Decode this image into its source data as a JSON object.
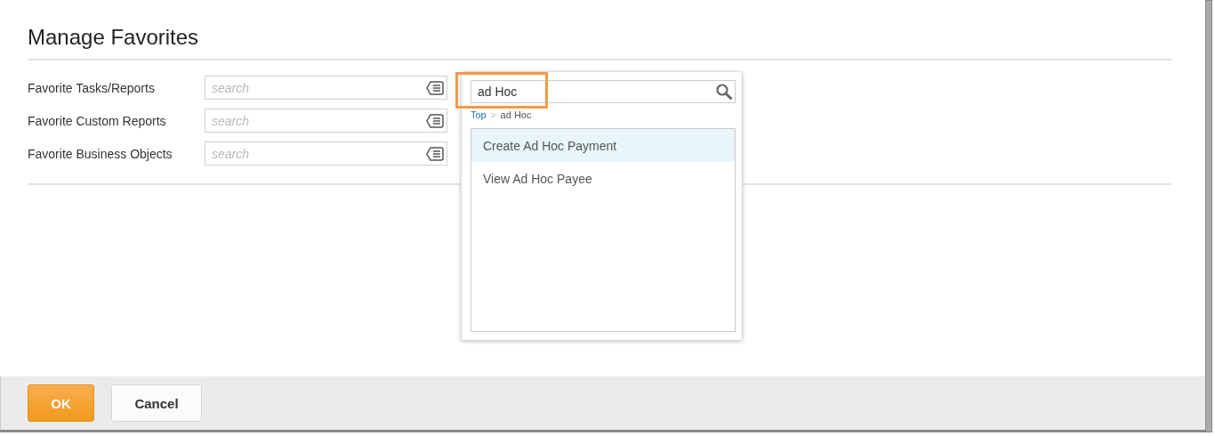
{
  "dialog": {
    "title": "Manage Favorites"
  },
  "fields": [
    {
      "label": "Favorite Tasks/Reports",
      "placeholder": "search"
    },
    {
      "label": "Favorite Custom Reports",
      "placeholder": "search"
    },
    {
      "label": "Favorite Business Objects",
      "placeholder": "search"
    }
  ],
  "popup": {
    "search_value": "ad Hoc",
    "highlighted": true,
    "breadcrumb_separator": ">",
    "breadcrumb": [
      {
        "label": "Top",
        "kind": "link"
      },
      {
        "label": "ad Hoc",
        "kind": "current"
      }
    ],
    "items": [
      {
        "label": "Create Ad Hoc Payment",
        "selected": true
      },
      {
        "label": "View Ad Hoc Payee",
        "selected": false
      }
    ]
  },
  "buttons": [
    {
      "label": "OK",
      "kind": "primary"
    },
    {
      "label": "Cancel",
      "kind": "secondary"
    }
  ]
}
